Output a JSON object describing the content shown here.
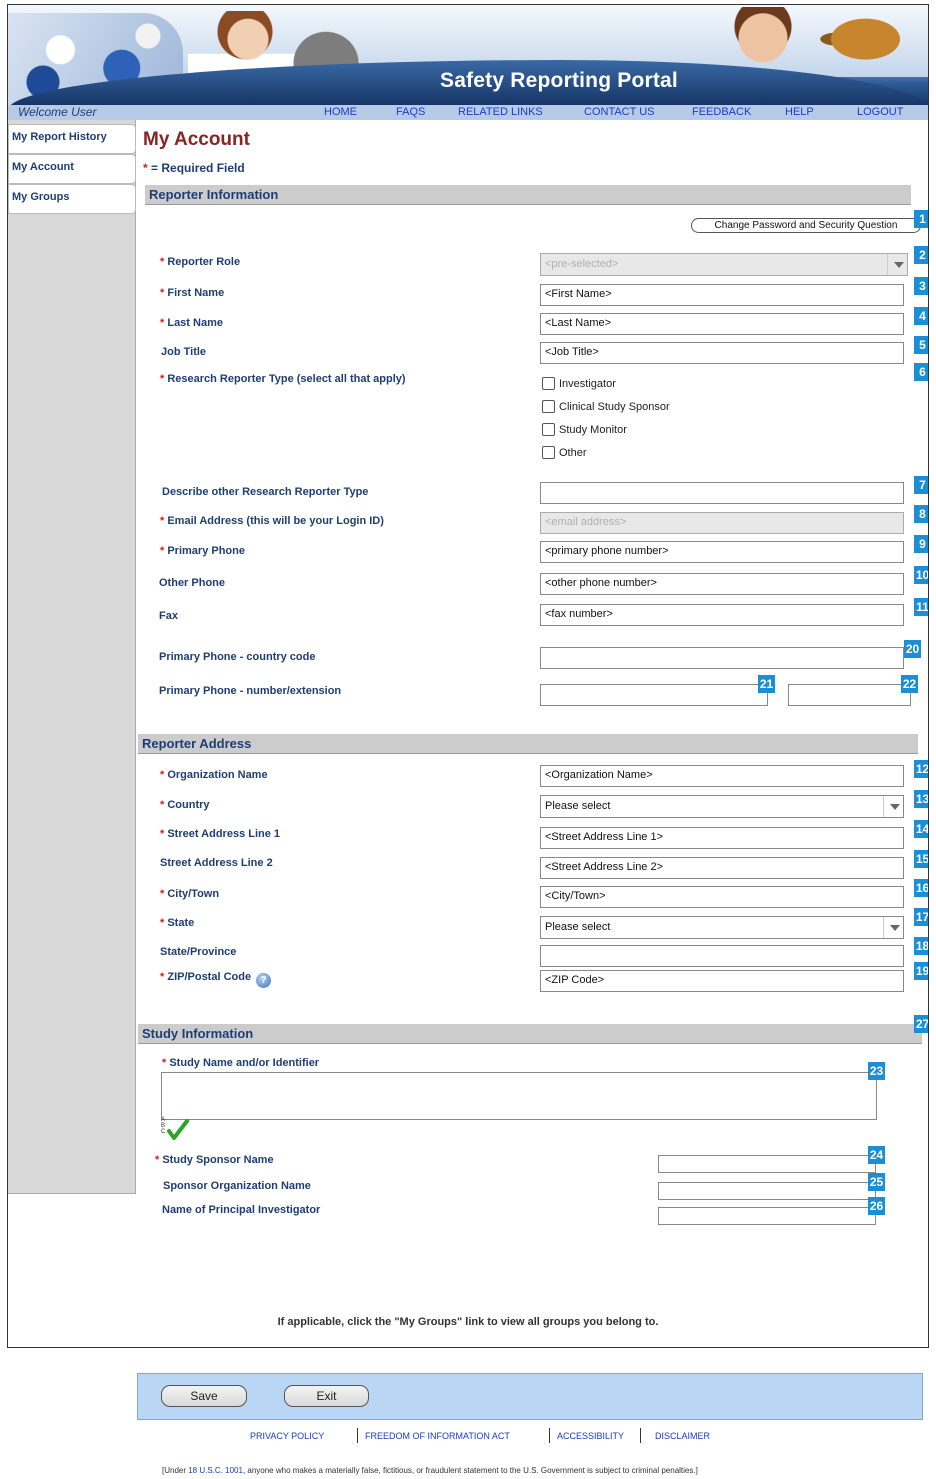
{
  "header": {
    "title": "Safety Reporting Portal",
    "welcome": "Welcome User"
  },
  "nav": [
    "HOME",
    "FAQS",
    "RELATED LINKS",
    "CONTACT US",
    "FEEDBACK",
    "HELP",
    "LOGOUT"
  ],
  "sidebar": [
    "My Report History",
    "My Account",
    "My Groups"
  ],
  "page": {
    "title": "My Account",
    "required_note": "= Required Field",
    "required_marker": "*"
  },
  "reporter_info": {
    "heading": "Reporter Information",
    "change_password_button": "Change Password and Security Question",
    "reporter_role": {
      "label": "Reporter Role",
      "value": "<pre-selected>"
    },
    "first_name": {
      "label": "First Name",
      "value": "<First Name>"
    },
    "last_name": {
      "label": "Last Name",
      "value": "<Last Name>"
    },
    "job_title": {
      "label": "Job Title",
      "value": "<Job Title>"
    },
    "research_type": {
      "label": "Research Reporter Type (select all that apply)",
      "options": [
        "Investigator",
        "Clinical Study Sponsor",
        "Study Monitor",
        "Other"
      ]
    },
    "describe_other": {
      "label": "Describe other Research Reporter Type",
      "value": ""
    },
    "email": {
      "label": "Email Address (this will be your Login ID)",
      "value": "<email address>"
    },
    "primary_phone": {
      "label": "Primary Phone",
      "value": "<primary phone number>"
    },
    "other_phone": {
      "label": "Other Phone",
      "value": "<other phone number>"
    },
    "fax": {
      "label": "Fax",
      "value": "<fax number>"
    },
    "country_code": {
      "label": "Primary Phone - country code",
      "value": ""
    },
    "number_ext": {
      "label": "Primary Phone - number/extension",
      "number": "",
      "extension": ""
    }
  },
  "reporter_address": {
    "heading": "Reporter Address",
    "org_name": {
      "label": "Organization Name",
      "value": "<Organization Name>"
    },
    "country": {
      "label": "Country",
      "value": "Please select"
    },
    "street1": {
      "label": "Street Address Line 1",
      "value": "<Street Address Line 1>"
    },
    "street2": {
      "label": "Street Address Line 2",
      "value": "<Street Address Line 2>"
    },
    "city": {
      "label": "City/Town",
      "value": "<City/Town>"
    },
    "state": {
      "label": "State",
      "value": "Please select"
    },
    "province": {
      "label": "State/Province",
      "value": ""
    },
    "zip": {
      "label": "ZIP/Postal Code",
      "value": "<ZIP Code>"
    }
  },
  "study_info": {
    "heading": "Study Information",
    "study_name": {
      "label": "Study Name and/or Identifier",
      "value": ""
    },
    "sponsor_name": {
      "label": "Study Sponsor Name",
      "value": ""
    },
    "sponsor_org": {
      "label": "Sponsor Organization Name",
      "value": ""
    },
    "principal_investigator": {
      "label": "Name of Principal Investigator",
      "value": ""
    },
    "spellcheck_letters": "A B C"
  },
  "badges": [
    "1",
    "2",
    "3",
    "4",
    "5",
    "6",
    "7",
    "8",
    "9",
    "10",
    "11",
    "12",
    "13",
    "14",
    "15",
    "16",
    "17",
    "18",
    "19",
    "20",
    "21",
    "22",
    "23",
    "24",
    "25",
    "26",
    "27"
  ],
  "groups_note": "If applicable, click the \"My Groups\" link to view all groups you belong to.",
  "buttons": {
    "save": "Save",
    "exit": "Exit"
  },
  "footer": {
    "links": [
      "PRIVACY POLICY",
      "FREEDOM OF INFORMATION ACT",
      "ACCESSIBILITY",
      "DISCLAIMER"
    ],
    "legal_pre": "[Under ",
    "legal_link": "18 U.S.C. 1001",
    "legal_post": ", anyone who makes a materially false, fictitious, or fraudulent statement to the U.S. Government is subject to criminal penalties.]"
  },
  "colors": {
    "accent_badge": "#1b8fd6",
    "title_red": "#8b2323",
    "label_navy": "#1f3d75",
    "nav_bar": "#b7cbe8",
    "button_bar": "#b9d6f5"
  }
}
